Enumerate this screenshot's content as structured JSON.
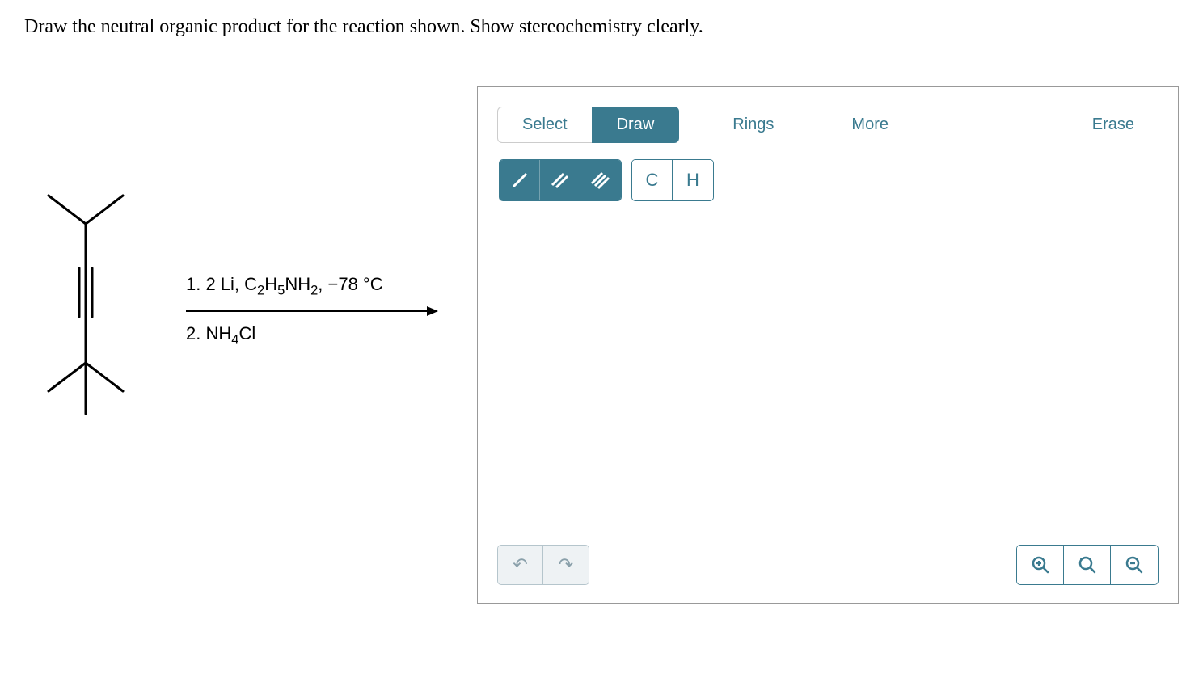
{
  "question": "Draw the neutral organic product for the reaction shown. Show stereochemistry clearly.",
  "reaction": {
    "condition1_prefix": "1. 2 Li, C",
    "condition1_sub1": "2",
    "condition1_mid1": "H",
    "condition1_sub2": "5",
    "condition1_mid2": "NH",
    "condition1_sub3": "2",
    "condition1_suffix": ", −78 °C",
    "condition2_prefix": "2. NH",
    "condition2_sub1": "4",
    "condition2_suffix": "Cl"
  },
  "toolbar": {
    "select": "Select",
    "draw": "Draw",
    "rings": "Rings",
    "more": "More",
    "erase": "Erase"
  },
  "atoms": {
    "carbon": "C",
    "hydrogen": "H"
  },
  "icons": {
    "undo": "↶",
    "redo": "↷"
  }
}
